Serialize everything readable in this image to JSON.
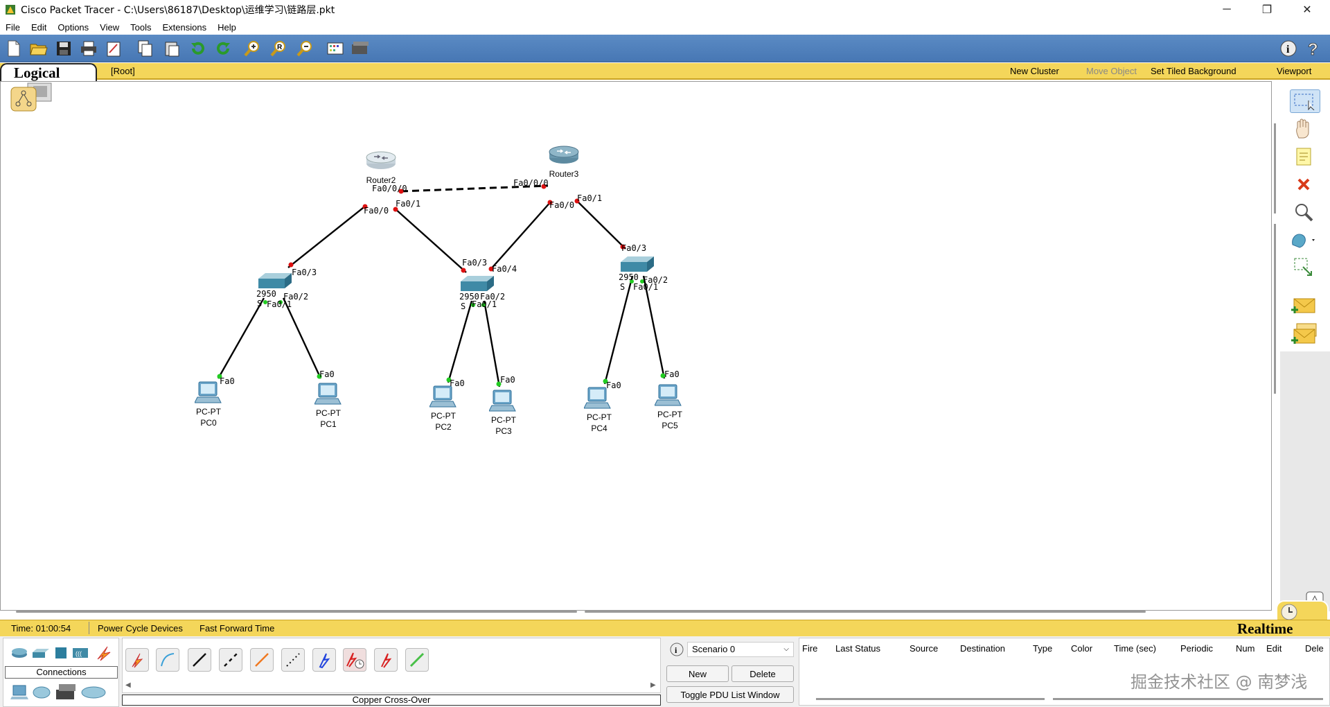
{
  "window": {
    "title": "Cisco Packet Tracer - C:\\Users\\86187\\Desktop\\运维学习\\链路层.pkt",
    "minimize": "─",
    "maximize": "❐",
    "close": "✕"
  },
  "menu": [
    "File",
    "Edit",
    "Options",
    "View",
    "Tools",
    "Extensions",
    "Help"
  ],
  "logicalbar": {
    "tab": "Logical",
    "root": "[Root]",
    "new_cluster": "New Cluster",
    "move_object": "Move Object",
    "set_tiled_background": "Set Tiled Background",
    "viewport": "Viewport"
  },
  "devices": {
    "router2": {
      "name": "Router2"
    },
    "router3": {
      "name": "Router3"
    },
    "switch0": {
      "model": "2950",
      "short": "S"
    },
    "switch1": {
      "model": "2950",
      "short": "S"
    },
    "switch2": {
      "model": "2950",
      "short": "S"
    },
    "pcs": [
      {
        "type": "PC-PT",
        "name": "PC0"
      },
      {
        "type": "PC-PT",
        "name": "PC1"
      },
      {
        "type": "PC-PT",
        "name": "PC2"
      },
      {
        "type": "PC-PT",
        "name": "PC3"
      },
      {
        "type": "PC-PT",
        "name": "PC4"
      },
      {
        "type": "PC-PT",
        "name": "PC5"
      }
    ]
  },
  "ports": {
    "r2_fa000": "Fa0/0/0",
    "r3_fa000": "Fa0/0/0",
    "r2_fa00": "Fa0/0",
    "r2_fa01": "Fa0/1",
    "r3_fa00": "Fa0/0",
    "r3_fa01": "Fa0/1",
    "s0_fa03": "Fa0/3",
    "s0_fa02": "Fa0/2",
    "s0_fa01": "Fa0/1",
    "s1_fa03": "Fa0/3",
    "s1_fa04": "Fa0/4",
    "s1_fa02": "Fa0/2",
    "s1_fa01": "Fa0/1",
    "s2_fa03": "Fa0/3",
    "s2_fa02": "Fa0/2",
    "s2_fa01": "Fa0/1",
    "pc_fa0": "Fa0"
  },
  "status": {
    "time": "Time: 01:00:54",
    "power_cycle": "Power Cycle Devices",
    "fast_forward": "Fast Forward Time",
    "mode": "Realtime"
  },
  "bottom": {
    "connections_label": "Connections",
    "selected_cable": "Copper Cross-Over",
    "scenario": "Scenario 0",
    "new": "New",
    "delete": "Delete",
    "toggle": "Toggle PDU List Window",
    "columns": [
      "Fire",
      "Last Status",
      "Source",
      "Destination",
      "Type",
      "Color",
      "Time (sec)",
      "Periodic",
      "Num",
      "Edit",
      "Dele"
    ]
  },
  "watermark": "掘金技术社区 @ 南梦浅",
  "colors": {
    "toolbar": "#4f80be",
    "yellowbar": "#f4d65a",
    "link_up": "#22cc22",
    "link_down": "#dd1111"
  }
}
